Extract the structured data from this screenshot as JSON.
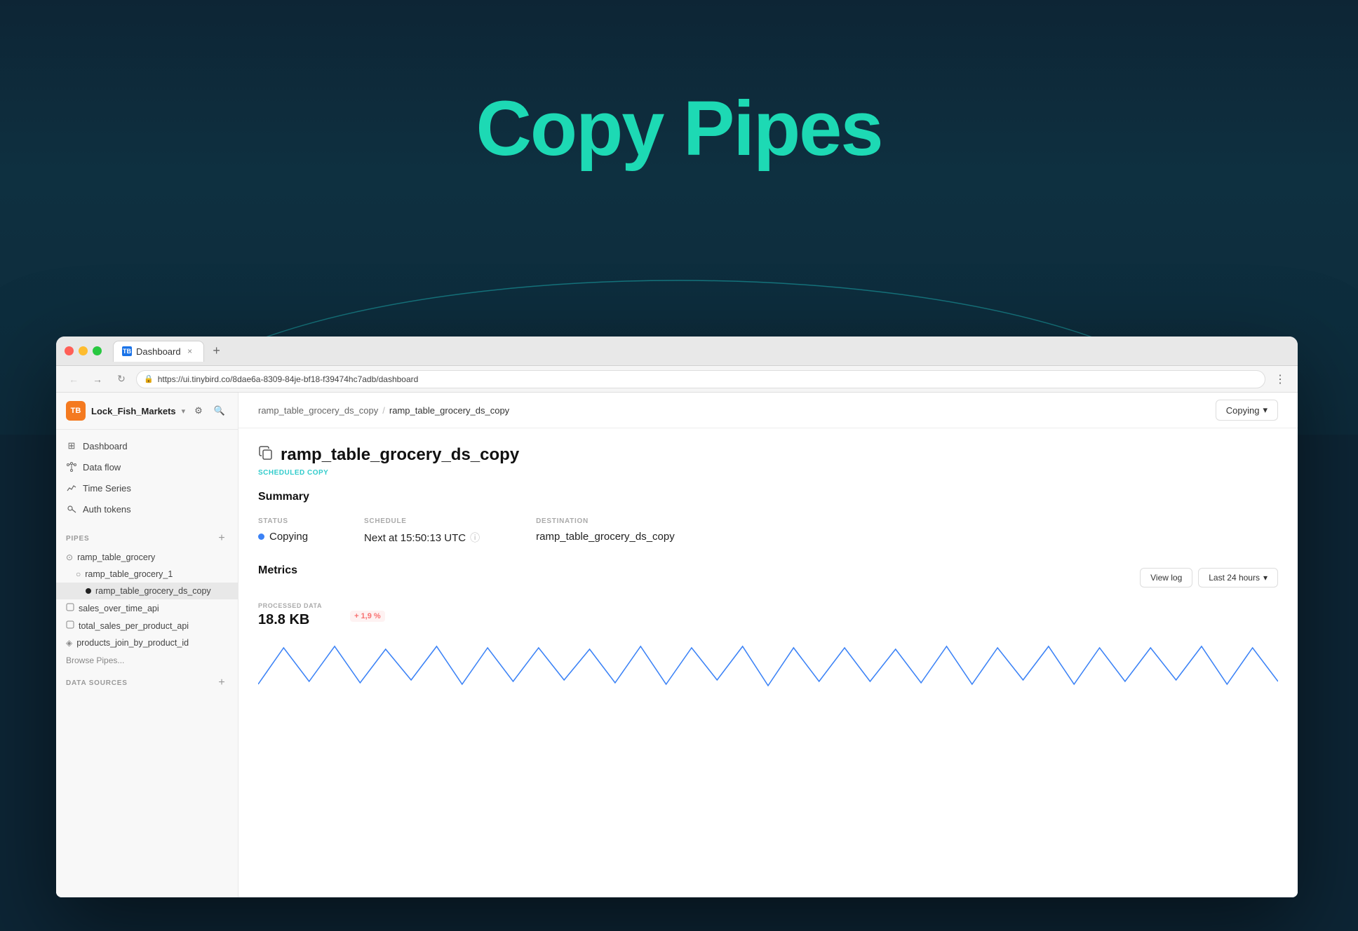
{
  "hero": {
    "title": "Copy Pipes",
    "accent_color": "#1dd9b4",
    "bg_color": "#0d2535"
  },
  "browser": {
    "tab_label": "Dashboard",
    "tab_favicon": "TB",
    "url": "https://ui.tinybird.co/8dae6a-8309-84je-bf18-f39474hc7adb/dashboard",
    "close_symbol": "×",
    "new_tab_symbol": "+",
    "more_symbol": "⋮"
  },
  "sidebar": {
    "workspace_name": "Lock_Fish_Markets",
    "workspace_initials": "TB",
    "nav_items": [
      {
        "label": "Dashboard",
        "icon": "⊞"
      },
      {
        "label": "Data flow",
        "icon": "⑆"
      },
      {
        "label": "Time Series",
        "icon": "📈"
      },
      {
        "label": "Auth tokens",
        "icon": "⚷"
      }
    ],
    "pipes_section_label": "PIPES",
    "pipes": [
      {
        "label": "ramp_table_grocery",
        "icon": "⊙",
        "level": 0
      },
      {
        "label": "ramp_table_grocery_1",
        "icon": "○",
        "level": 1
      },
      {
        "label": "ramp_table_grocery_ds_copy",
        "icon": "●",
        "level": 2,
        "active": true
      },
      {
        "label": "sales_over_time_api",
        "icon": "□",
        "level": 0
      },
      {
        "label": "total_sales_per_product_api",
        "icon": "□",
        "level": 0
      },
      {
        "label": "products_join_by_product_id",
        "icon": "◈",
        "level": 0
      }
    ],
    "browse_label": "Browse Pipes...",
    "data_sources_label": "DATA SOURCES"
  },
  "breadcrumb": {
    "parent": "ramp_table_grocery_ds_copy",
    "separator": "/",
    "current": "ramp_table_grocery_ds_copy"
  },
  "copy_button": {
    "label": "Copying",
    "chevron": "▾"
  },
  "page": {
    "icon": "⧉",
    "title": "ramp_table_grocery_ds_copy",
    "tag": "SCHEDULED COPY",
    "summary_section_title": "Summary",
    "status_label": "STATUS",
    "status_value": "Copying",
    "status_dot_color": "#3b82f6",
    "schedule_label": "SCHEDULE",
    "schedule_value": "Next at 15:50:13 UTC",
    "destination_label": "DESTINATION",
    "destination_value": "ramp_table_grocery_ds_copy",
    "metrics_section_title": "Metrics",
    "view_log_label": "View log",
    "time_range_label": "Last 24 hours",
    "processed_data_label": "PROCESSED DATA",
    "processed_data_value": "18.8 KB",
    "change_badge": "+ 1,9 %"
  },
  "chart": {
    "color": "#3b82f6",
    "bars": [
      12,
      68,
      20,
      72,
      18,
      65,
      22,
      70,
      16,
      69,
      20,
      68,
      22,
      65,
      19,
      71,
      18,
      67,
      22,
      70,
      15,
      69,
      21,
      68,
      20,
      66,
      19,
      72,
      18,
      68,
      22,
      70,
      16,
      69,
      20,
      66,
      21,
      70,
      18,
      68
    ]
  }
}
